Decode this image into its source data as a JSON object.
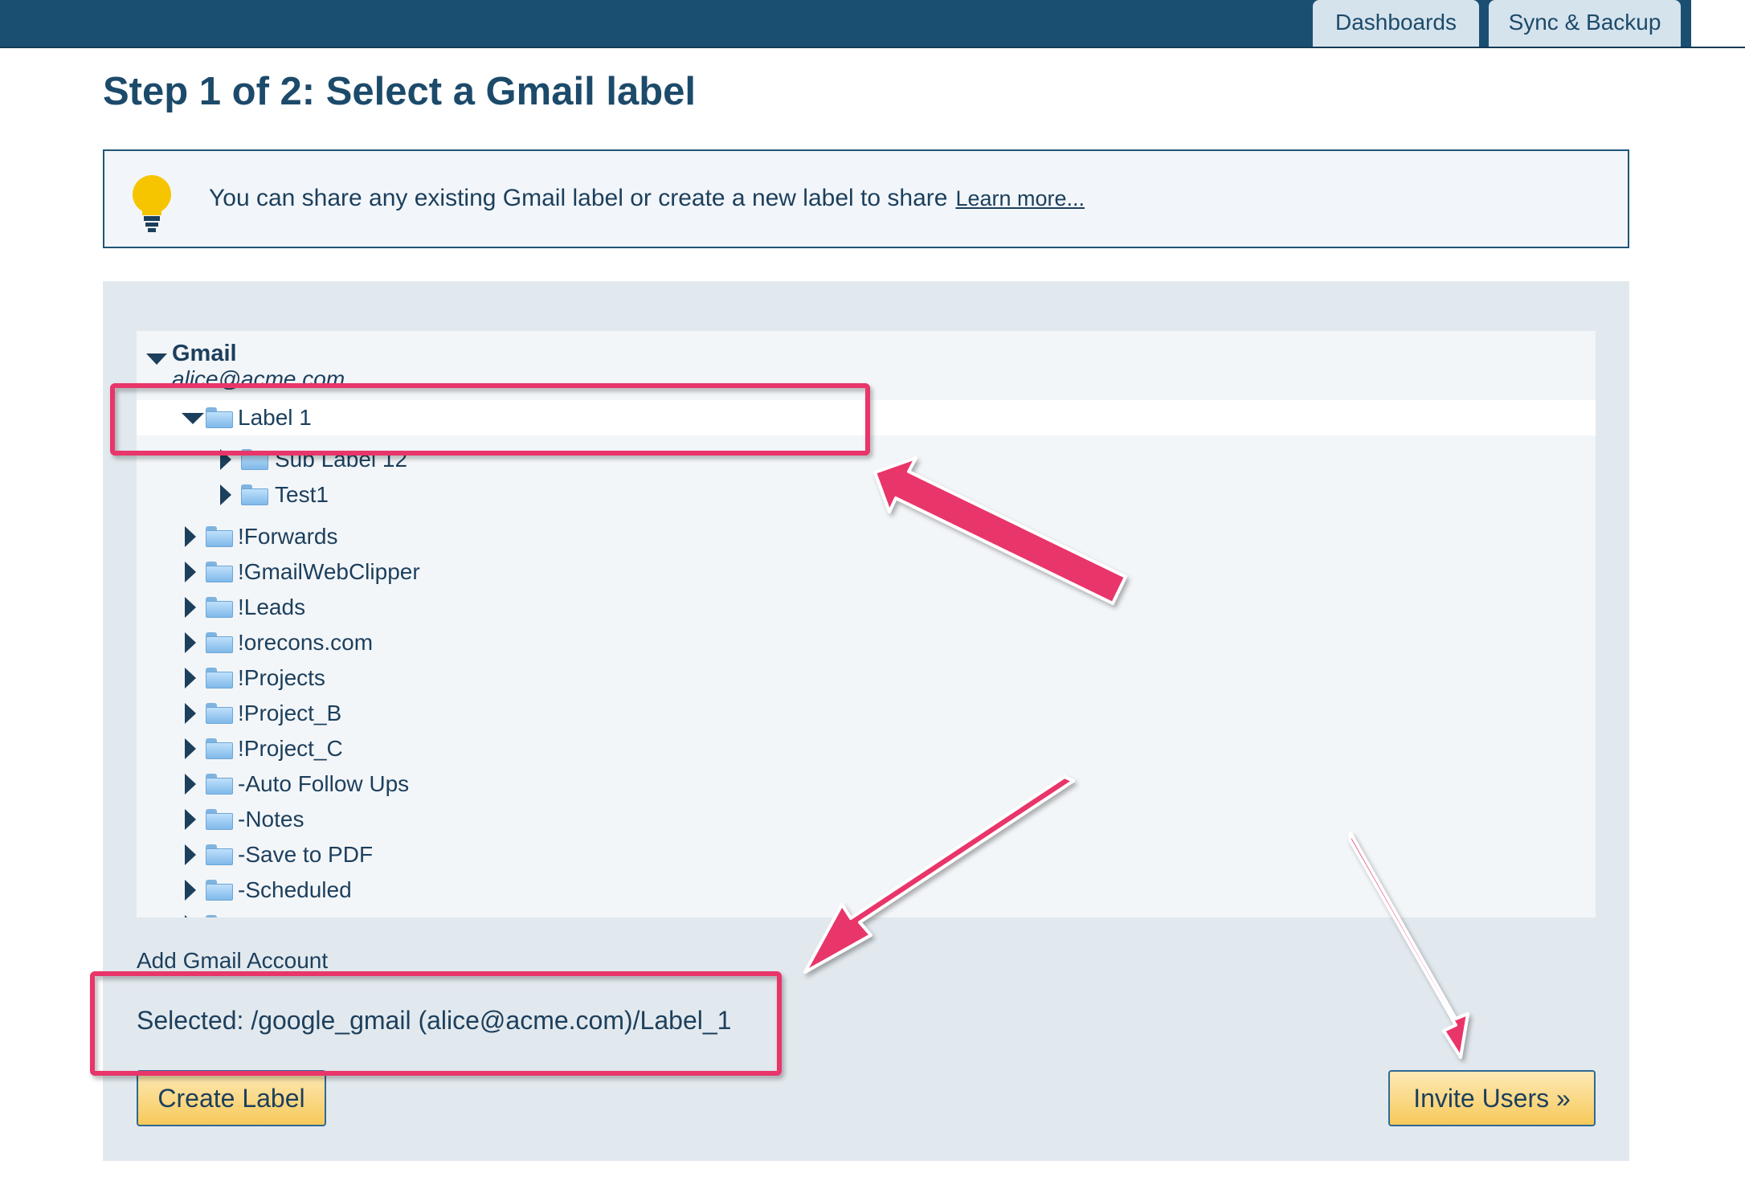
{
  "nav": {
    "tabs": [
      {
        "label": "Dashboards"
      },
      {
        "label": "Sync & Backup"
      }
    ]
  },
  "page": {
    "title": "Step 1 of 2: Select a Gmail label"
  },
  "tip": {
    "icon": "lightbulb-icon",
    "text": "You can share any existing Gmail label or create a new label to share",
    "link": "Learn more..."
  },
  "tree": {
    "root": {
      "name": "Gmail",
      "email": "alice@acme.com"
    },
    "selected_label": "Label 1",
    "sub_items": [
      "Sub Label 12",
      "Test1"
    ],
    "items": [
      "!Forwards",
      "!GmailWebClipper",
      "!Leads",
      "!orecons.com",
      "!Projects",
      "!Project_B",
      "!Project_C",
      "-Auto Follow Ups",
      "-Notes",
      "-Save to PDF",
      "-Scheduled"
    ]
  },
  "panel": {
    "add_account": "Add Gmail Account",
    "selected_path": "Selected: /google_gmail (alice@acme.com)/Label_1"
  },
  "buttons": {
    "create_label": "Create Label",
    "invite_users": "Invite Users  »"
  },
  "colors": {
    "header": "#1b4f72",
    "annotation": "#e8366b",
    "button_fill": "#f7c95a"
  }
}
